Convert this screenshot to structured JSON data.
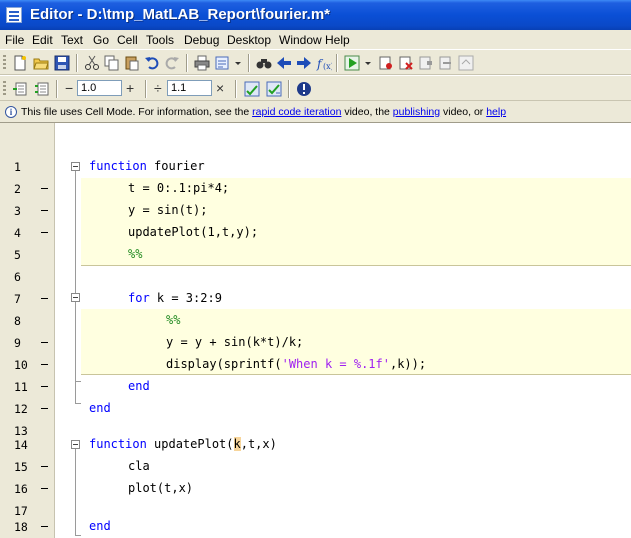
{
  "window": {
    "title": "Editor - D:\\tmp_MatLAB_Report\\fourier.m*"
  },
  "menu": [
    "File",
    "Edit",
    "Text",
    "Go",
    "Cell",
    "Tools",
    "Debug",
    "Desktop",
    "Window",
    "Help"
  ],
  "cell_toolbar": {
    "minus": "−",
    "value1": "1.0",
    "plus": "+",
    "divide": "÷",
    "value2": "1.1",
    "times": "×"
  },
  "info": {
    "prefix": "This file uses Cell Mode. For information, see the ",
    "link1": "rapid code iteration",
    "mid1": " video, the ",
    "link2": "publishing",
    "mid2": " video, or ",
    "link3": "help"
  },
  "lines": [
    {
      "num": "1",
      "code": "function fourier"
    },
    {
      "num": "2",
      "code": "t = 0:.1:pi*4;"
    },
    {
      "num": "3",
      "code": "y = sin(t);"
    },
    {
      "num": "4",
      "code": "updatePlot(1,t,y);"
    },
    {
      "num": "5",
      "code": "%%"
    },
    {
      "num": "6",
      "code": ""
    },
    {
      "num": "7",
      "code": "for k = 3:2:9"
    },
    {
      "num": "8",
      "code": "%%"
    },
    {
      "num": "9",
      "code": "y = y + sin(k*t)/k;"
    },
    {
      "num": "10",
      "code": "display(sprintf('When k = %.1f',k));"
    },
    {
      "num": "11",
      "code": "end"
    },
    {
      "num": "12",
      "code": "end"
    },
    {
      "num": "13",
      "code": ""
    },
    {
      "num": "14",
      "code": "function updatePlot(k,t,x)"
    },
    {
      "num": "15",
      "code": "cla"
    },
    {
      "num": "16",
      "code": "plot(t,x)"
    },
    {
      "num": "17",
      "code": ""
    },
    {
      "num": "18",
      "code": "end"
    }
  ],
  "code_tokens": {
    "kw_function": "function",
    "fourier": " fourier",
    "kw_for": "for",
    "for_rest": " k = 3:2:9",
    "kw_end": "end",
    "up_pre": " updatePlot(",
    "up_k": "k",
    "up_post": ",t,x)",
    "disp_pre": "display(sprintf(",
    "disp_str": "'When k = %.1f'",
    "disp_post": ",k));",
    "cell_marker": "%%"
  },
  "colors": {
    "keyword": "#0000ff",
    "comment": "#228b22",
    "string": "#a020f0",
    "cell_bg": "#ffffe0",
    "title_bar": "#0a4fd6"
  }
}
